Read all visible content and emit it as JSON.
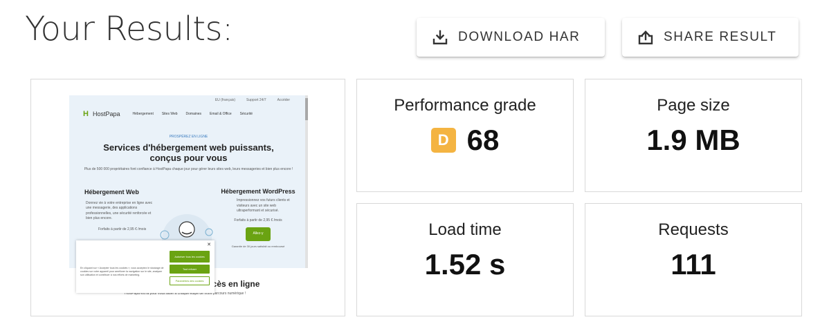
{
  "page": {
    "title": "Your Results:"
  },
  "actions": {
    "download_label": "DOWNLOAD HAR",
    "share_label": "SHARE RESULT"
  },
  "metrics": {
    "performance": {
      "label": "Performance grade",
      "grade": "D",
      "value": "68",
      "grade_color": "#f4b442"
    },
    "page_size": {
      "label": "Page size",
      "value": "1.9 MB"
    },
    "load_time": {
      "label": "Load time",
      "value": "1.52 s"
    },
    "requests": {
      "label": "Requests",
      "value": "111"
    }
  },
  "screenshot": {
    "top_links": [
      "EU (français)",
      "Support 24/7",
      "Accéder"
    ],
    "brand": "HostPapa",
    "nav": [
      "Hébergement",
      "Sites Web",
      "Domaines",
      "Email & Office",
      "Sécurité"
    ],
    "kicker": "PROSPÉREZ EN LIGNE",
    "headline": "Services d'hébergement web puissants, conçus pour vous",
    "subline": "Plus de 500 000 propriétaires font confiance à HostPapa chaque jour pour gérer leurs sites web, leurs messageries et bien plus encore !",
    "left_heading": "Hébergement Web",
    "left_text": "Donnez vie à votre entreprise en ligne avec une messagerie, des applications professionnelles, une sécurité renforcée et bien plus encore.",
    "left_price": "Forfaits à partir de 2,95 € /mois",
    "right_heading": "Hébergement WordPress",
    "right_text": "Impressionnez vos futurs clients et visiteurs avec un site web ultraperformant et sécurisé.",
    "right_price": "Forfaits à partir de 2,95 € /mois",
    "right_button": "Allez-y",
    "right_note": "Garantie de 30 jours satisfait ou remboursé",
    "cookie_text": "En cliquant sur « Accepter tous les cookies », vous acceptez le stockage de cookies sur votre appareil pour améliorer la navigation sur le site, analyser son utilisation et contribuer à nos efforts de marketing.",
    "cookie_accept": "Autoriser tous les cookies",
    "cookie_reject": "Tout refuser",
    "cookie_settings": "Paramètres des cookies",
    "bottom_heading": "ccès en ligne",
    "bottom_sub": "HostPapa est là pour vous aider à chaque étape de votre parcours numérique !",
    "accent_color": "#6aa312"
  }
}
